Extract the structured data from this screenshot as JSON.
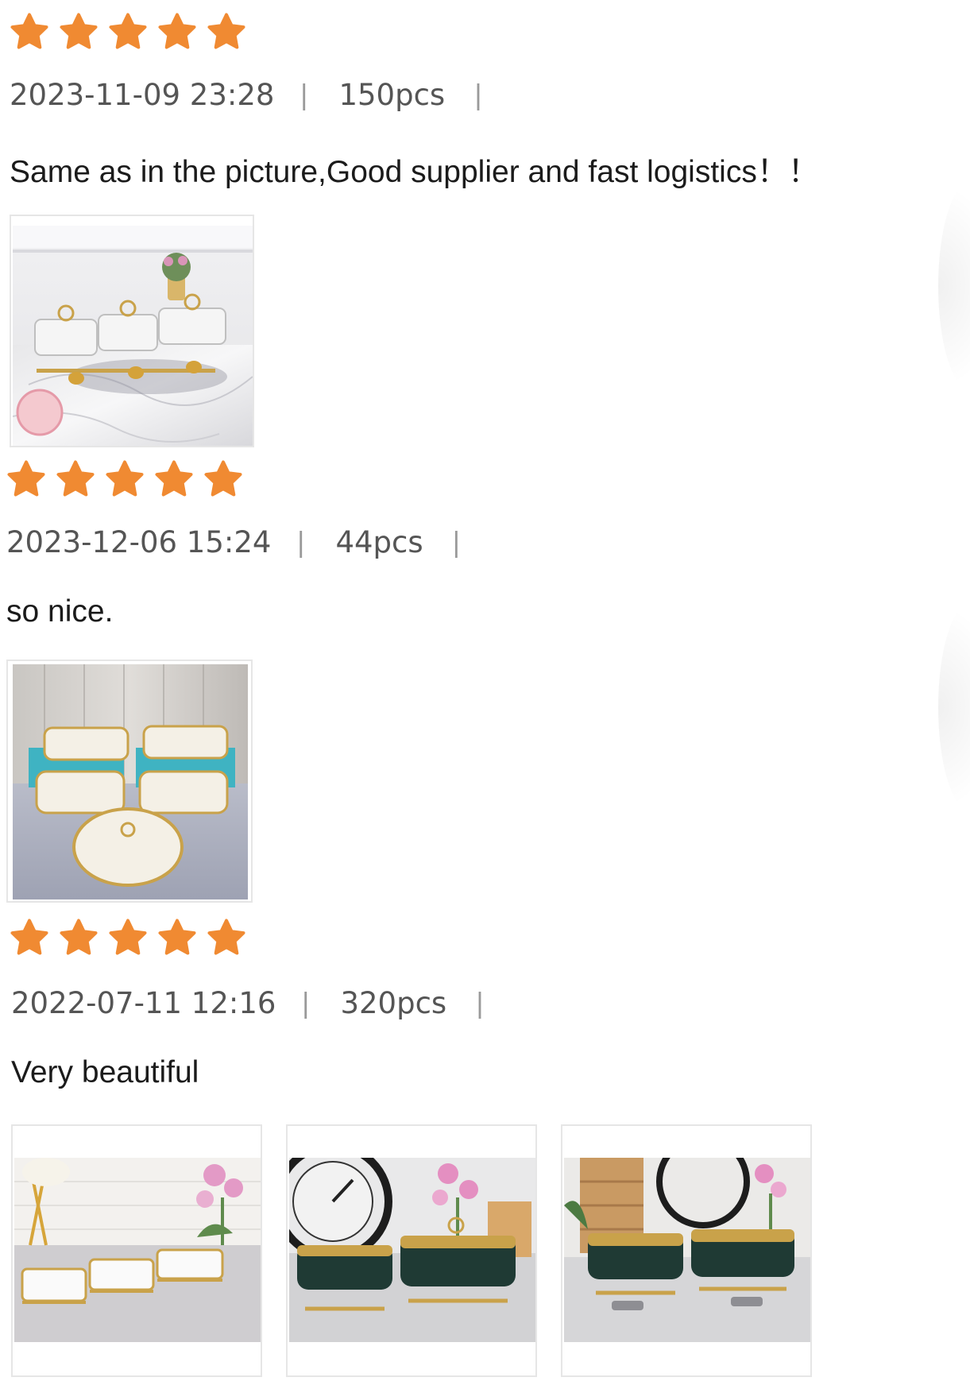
{
  "colors": {
    "star": "#f08a32",
    "meta_text": "#555555",
    "comment_text": "#1b1b1b"
  },
  "reviews": [
    {
      "rating": 5,
      "date": "2023-11-09 23:28",
      "separator": "|",
      "quantity": "150pcs",
      "comment": "Same as in the picture,Good supplier and fast logistics！！",
      "photos": [
        "product-photo"
      ]
    },
    {
      "rating": 5,
      "date": "2023-12-06 15:24",
      "separator": "|",
      "quantity": "44pcs",
      "comment": "so nice.",
      "photos": [
        "product-photo"
      ]
    },
    {
      "rating": 5,
      "date": "2022-07-11 12:16",
      "separator": "|",
      "quantity": "320pcs",
      "comment": "Very beautiful",
      "photos": [
        "product-photo",
        "product-photo",
        "product-photo"
      ]
    }
  ]
}
